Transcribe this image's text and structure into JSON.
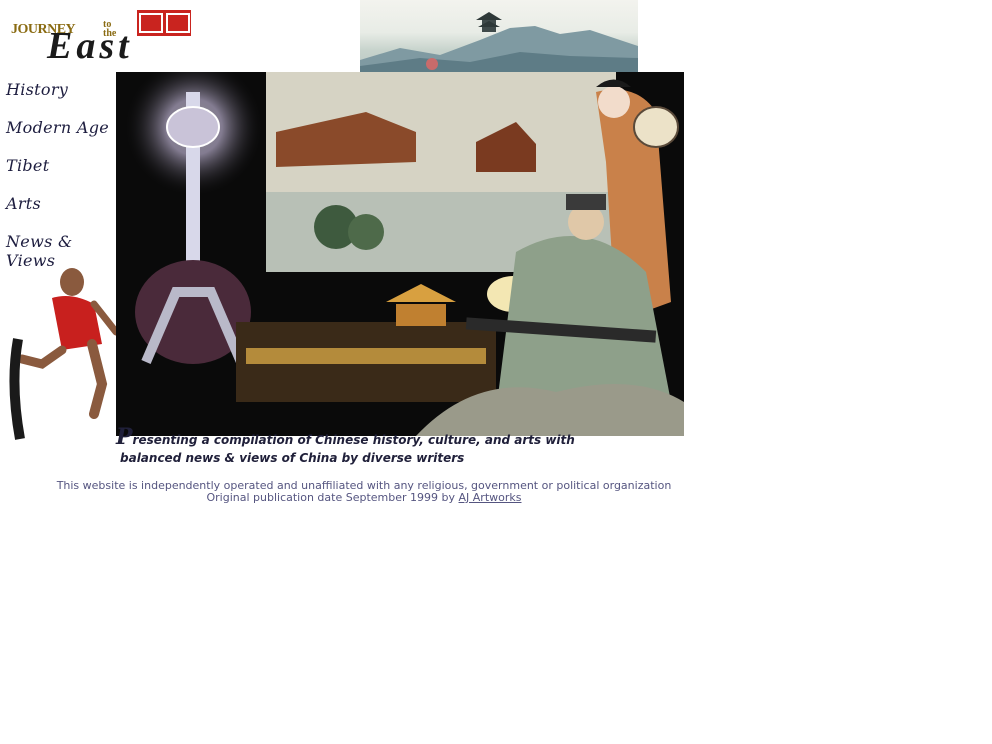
{
  "logo": {
    "word_journey": "JOURNEY",
    "word_to": "to",
    "word_the": "the",
    "word_east": "East"
  },
  "nav": {
    "items": [
      {
        "label": "History"
      },
      {
        "label": "Modern Age"
      },
      {
        "label": "Tibet"
      },
      {
        "label": "Arts"
      },
      {
        "label": "News & Views"
      }
    ]
  },
  "caption": {
    "dropcap": "P",
    "line1_rest": "resenting a compilation of Chinese history, culture, and arts with",
    "line2": "balanced news & views of China by diverse writers"
  },
  "footer": {
    "disclaimer": "This website is independently operated and unaffiliated with any religious, government or political organization",
    "publication": "Original publication date September 1999 by",
    "author_link": "AJ Artworks"
  },
  "colors": {
    "nav_text": "#1d1d3f",
    "footer_text": "#555580",
    "seal_red": "#c9241f"
  }
}
